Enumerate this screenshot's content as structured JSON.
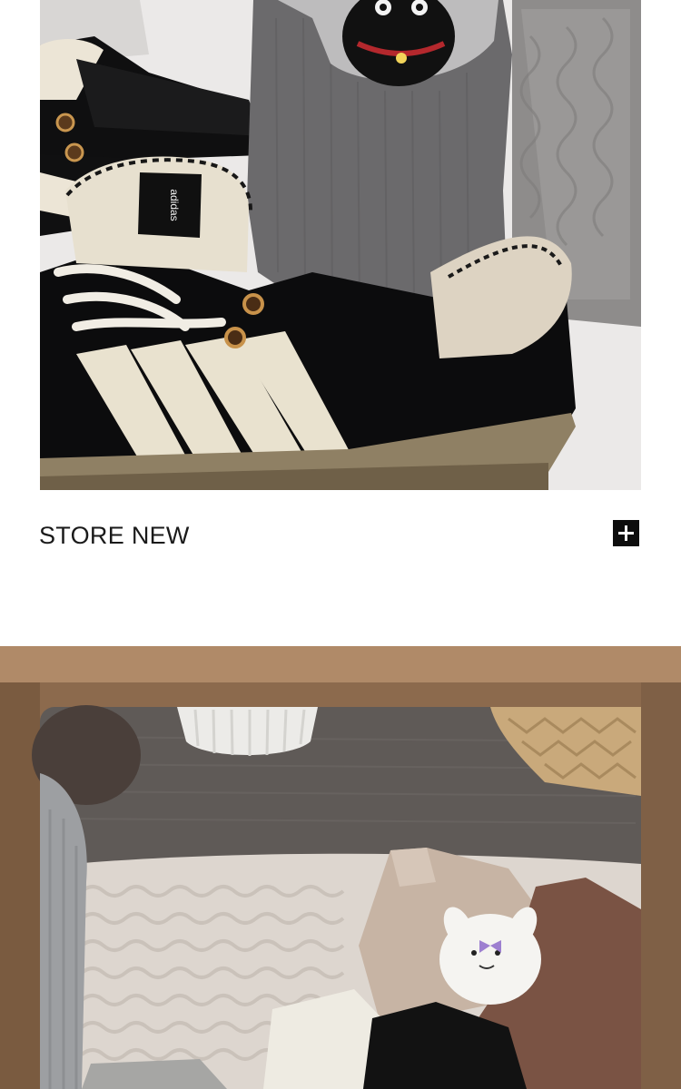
{
  "section": {
    "caption": "STORE NEW",
    "expand_icon": "plus-icon"
  },
  "photos": {
    "top": {
      "icon": "product-photo",
      "subject": "sneaker-with-sock"
    },
    "bottom": {
      "icon": "product-photo",
      "subject": "socks-on-rug"
    }
  }
}
